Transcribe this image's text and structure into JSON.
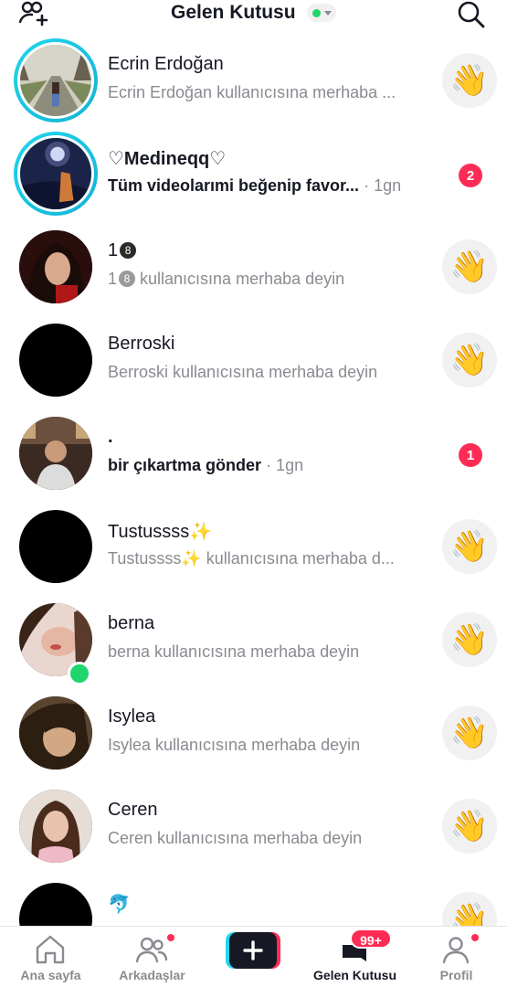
{
  "header": {
    "title": "Gelen Kutusu",
    "status": "online",
    "status_color": "#20d56b",
    "add_friend_icon": "add-friend-icon",
    "search_icon": "search-icon"
  },
  "conversations": [
    {
      "name": "Ecrin Erdoğan",
      "message": "Ecrin Erdoğan kullanıcısına merhaba ...",
      "time": "",
      "unread": "",
      "story": true,
      "online": false
    },
    {
      "name": "♡Medineqq♡",
      "message": "Tüm videolarımi beğenip favor...",
      "time": "· 1gn",
      "unread": "2",
      "story": true,
      "online": false
    },
    {
      "name": "1",
      "message": " kullanıcısına merhaba deyin",
      "time": "",
      "unread": "",
      "story": false,
      "online": false
    },
    {
      "name": "Berroski",
      "message": "Berroski kullanıcısına merhaba deyin",
      "time": "",
      "unread": "",
      "story": false,
      "online": false
    },
    {
      "name": ".",
      "message": "bir çıkartma gönder",
      "time": "· 1gn",
      "unread": "1",
      "story": false,
      "online": false
    },
    {
      "name": "Tustussss",
      "message": "Tustussss",
      "message_suffix": " kullanıcısına merhaba d...",
      "time": "",
      "unread": "",
      "story": false,
      "online": false
    },
    {
      "name": "berna",
      "message": "berna kullanıcısına merhaba deyin",
      "time": "",
      "unread": "",
      "story": false,
      "online": true
    },
    {
      "name": "Isylea",
      "message": "Isylea kullanıcısına merhaba deyin",
      "time": "",
      "unread": "",
      "story": false,
      "online": false
    },
    {
      "name": "Ceren",
      "message": "Ceren kullanıcısına merhaba deyin",
      "time": "",
      "unread": "",
      "story": false,
      "online": false
    },
    {
      "name": "🐬",
      "message": "",
      "time": "",
      "unread": "",
      "story": false,
      "online": false
    }
  ],
  "eight_ball": "8",
  "sparkle": "✨",
  "nav": {
    "home": "Ana sayfa",
    "friends": "Arkadaşlar",
    "inbox": "Gelen Kutusu",
    "profile": "Profil",
    "inbox_badge": "99+"
  },
  "colors": {
    "accent": "#fe2c55",
    "story_ring": "#20d5ec",
    "online": "#20d56b"
  }
}
